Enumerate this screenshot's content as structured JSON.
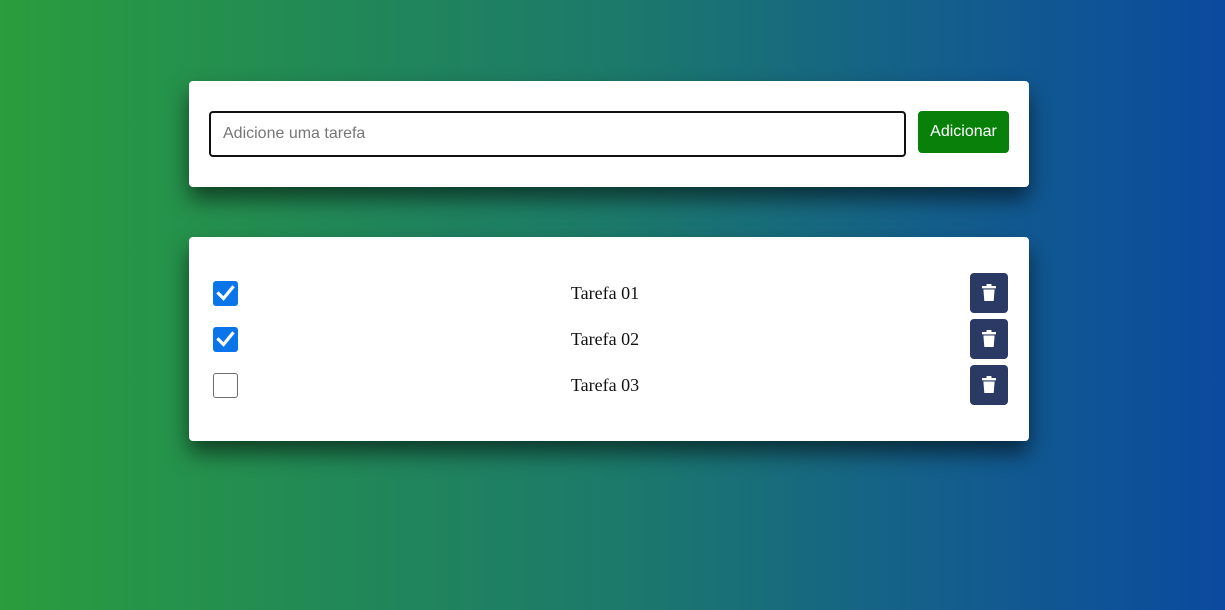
{
  "add_form": {
    "input_placeholder": "Adicione uma tarefa",
    "input_value": "",
    "add_label": "Adicionar"
  },
  "tasks": [
    {
      "label": "Tarefa 01",
      "checked": true
    },
    {
      "label": "Tarefa 02",
      "checked": true
    },
    {
      "label": "Tarefa 03",
      "checked": false
    }
  ],
  "icons": {
    "checkbox_check": "check-icon",
    "delete": "trash-icon"
  },
  "colors": {
    "add_button": "#08800a",
    "delete_button": "#2b3a64",
    "checkbox_checked": "#0a74ea"
  }
}
